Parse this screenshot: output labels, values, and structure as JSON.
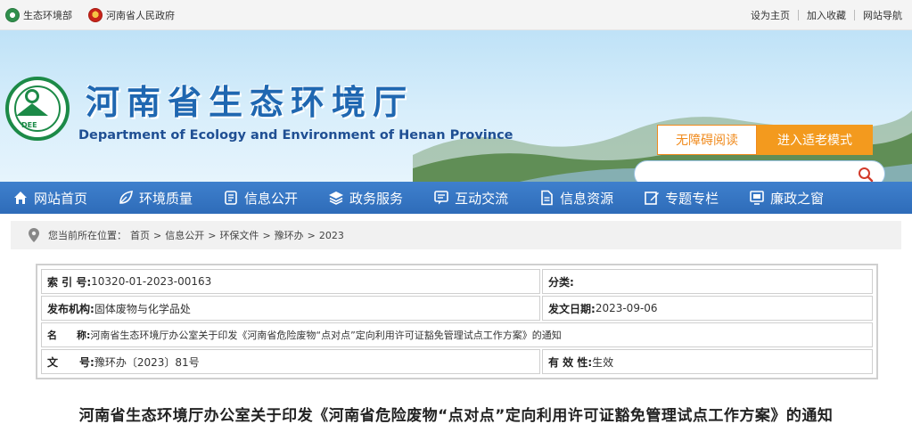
{
  "topbar": {
    "left_links": [
      {
        "label": "生态环境部",
        "icon": "ministry-emblem-icon"
      },
      {
        "label": "河南省人民政府",
        "icon": "national-emblem-icon"
      }
    ],
    "right_links": [
      "设为主页",
      "加入收藏",
      "网站导航"
    ]
  },
  "banner": {
    "title": "河南省生态环境厅",
    "subtitle": "Department of Ecology and Environment of Henan Province",
    "logo_text": "DEE",
    "accessibility_button": "无障碍阅读",
    "elder_mode_button": "进入适老模式",
    "search_placeholder": ""
  },
  "nav": {
    "items": [
      {
        "label": "网站首页",
        "icon": "home-icon"
      },
      {
        "label": "环境质量",
        "icon": "leaf-icon"
      },
      {
        "label": "信息公开",
        "icon": "document-icon"
      },
      {
        "label": "政务服务",
        "icon": "layers-icon"
      },
      {
        "label": "互动交流",
        "icon": "chat-icon"
      },
      {
        "label": "信息资源",
        "icon": "file-icon"
      },
      {
        "label": "专题专栏",
        "icon": "edit-icon"
      },
      {
        "label": "廉政之窗",
        "icon": "monitor-icon"
      }
    ]
  },
  "breadcrumb": {
    "prefix": "您当前所在位置：",
    "items": [
      "首页",
      "信息公开",
      "环保文件",
      "豫环办",
      "2023"
    ],
    "separator": ">"
  },
  "info": {
    "index_label": "索 引 号:",
    "index_value": "10320-01-2023-00163",
    "category_label": "分类:",
    "category_value": "",
    "publisher_label": "发布机构:",
    "publisher_value": "固体废物与化学品处",
    "date_label": "发文日期:",
    "date_value": "2023-09-06",
    "name_label": "名　　称:",
    "name_value": "河南省生态环境厅办公室关于印发《河南省危险废物“点对点”定向利用许可证豁免管理试点工作方案》的通知",
    "docno_label": "文　　号:",
    "docno_value": "豫环办〔2023〕81号",
    "validity_label": "有 效 性:",
    "validity_value": "生效"
  },
  "document": {
    "title": "河南省生态环境厅办公室关于印发《河南省危险废物“点对点”定向利用许可证豁免管理试点工作方案》的通知"
  },
  "colors": {
    "nav_blue": "#3575c4",
    "title_blue": "#1f67b1",
    "orange": "#f39a1e",
    "logo_green": "#1c8a47"
  }
}
